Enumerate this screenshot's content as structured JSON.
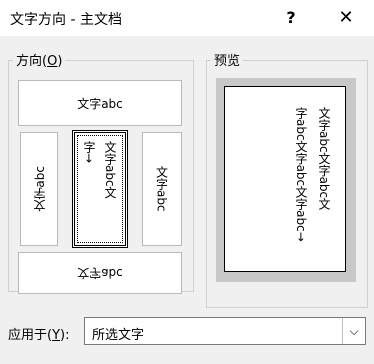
{
  "window": {
    "title": "文字方向 - 主文档",
    "help": "?",
    "close": "✕"
  },
  "direction": {
    "label": "方向(",
    "accel": "O",
    "label_end": ")",
    "options": {
      "horizontal": "文字abc",
      "vertical_up": "文字abc",
      "vertical_stacked_col1": "文字abc文",
      "vertical_stacked_col2": "字→",
      "vertical_down": "文字abc",
      "horizontal_flipped": "文字abc"
    }
  },
  "preview": {
    "label": "预览",
    "col1": "文字abc文字abc文",
    "col2": "字abc文字abc文字abc→"
  },
  "apply_to": {
    "label": "应用于(",
    "accel": "Y",
    "label_end": "):",
    "value": "所选文字",
    "arrow": "⌵"
  }
}
